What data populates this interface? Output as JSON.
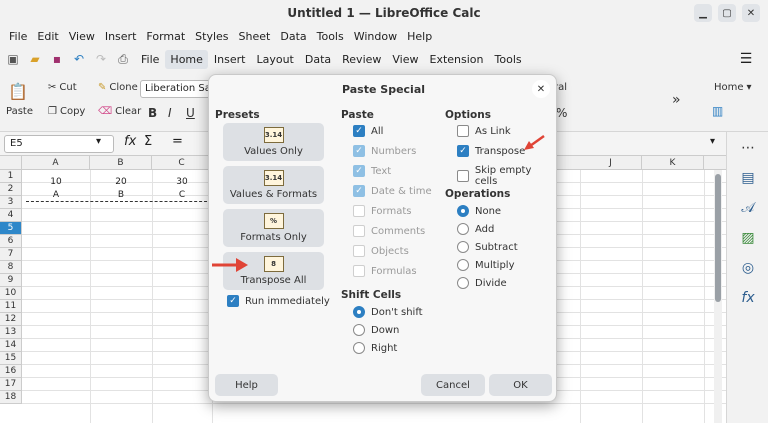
{
  "window": {
    "title": "Untitled 1 — LibreOffice Calc"
  },
  "menu": [
    "File",
    "Edit",
    "View",
    "Insert",
    "Format",
    "Styles",
    "Sheet",
    "Data",
    "Tools",
    "Window",
    "Help"
  ],
  "tabs": [
    "File",
    "Home",
    "Insert",
    "Layout",
    "Data",
    "Review",
    "View",
    "Extension",
    "Tools"
  ],
  "toolbar": {
    "paste": "Paste",
    "cut": "Cut",
    "copy": "Copy",
    "clone": "Clone",
    "clear": "Clear",
    "font": "Liberation Sa",
    "right_home": "Home",
    "partial_style": "ral"
  },
  "namebox": {
    "value": "E5"
  },
  "sheet": {
    "columns": [
      "A",
      "B",
      "C",
      "J",
      "K"
    ],
    "rows": [
      "1",
      "2",
      "3",
      "4",
      "5",
      "6",
      "7",
      "8",
      "9",
      "10",
      "11",
      "12",
      "13",
      "14",
      "15",
      "16",
      "17",
      "18"
    ],
    "row1": [
      "10",
      "20",
      "30"
    ],
    "row2": [
      "A",
      "B",
      "C"
    ],
    "selected_row": "5"
  },
  "dialog": {
    "title": "Paste Special",
    "presets_title": "Presets",
    "presets": [
      {
        "label": "Values Only",
        "icon_text": "3.14"
      },
      {
        "label": "Values & Formats",
        "icon_text": "3.14"
      },
      {
        "label": "Formats Only",
        "icon_text": "%"
      },
      {
        "label": "Transpose All",
        "icon_text": "8"
      }
    ],
    "run_immediately": "Run immediately",
    "paste_title": "Paste",
    "paste_items": [
      "All",
      "Numbers",
      "Text",
      "Date & time",
      "Formats",
      "Comments",
      "Objects",
      "Formulas"
    ],
    "shift_title": "Shift Cells",
    "shift_items": [
      "Don't shift",
      "Down",
      "Right"
    ],
    "options_title": "Options",
    "options": [
      "As Link",
      "Transpose",
      "Skip empty cells"
    ],
    "operations_title": "Operations",
    "operations": [
      "None",
      "Add",
      "Subtract",
      "Multiply",
      "Divide"
    ],
    "buttons": {
      "help": "Help",
      "cancel": "Cancel",
      "ok": "OK"
    }
  },
  "colors": {
    "accent": "#2d7fc2",
    "arrow": "#e04436",
    "selected_row": "#2e87c9"
  }
}
